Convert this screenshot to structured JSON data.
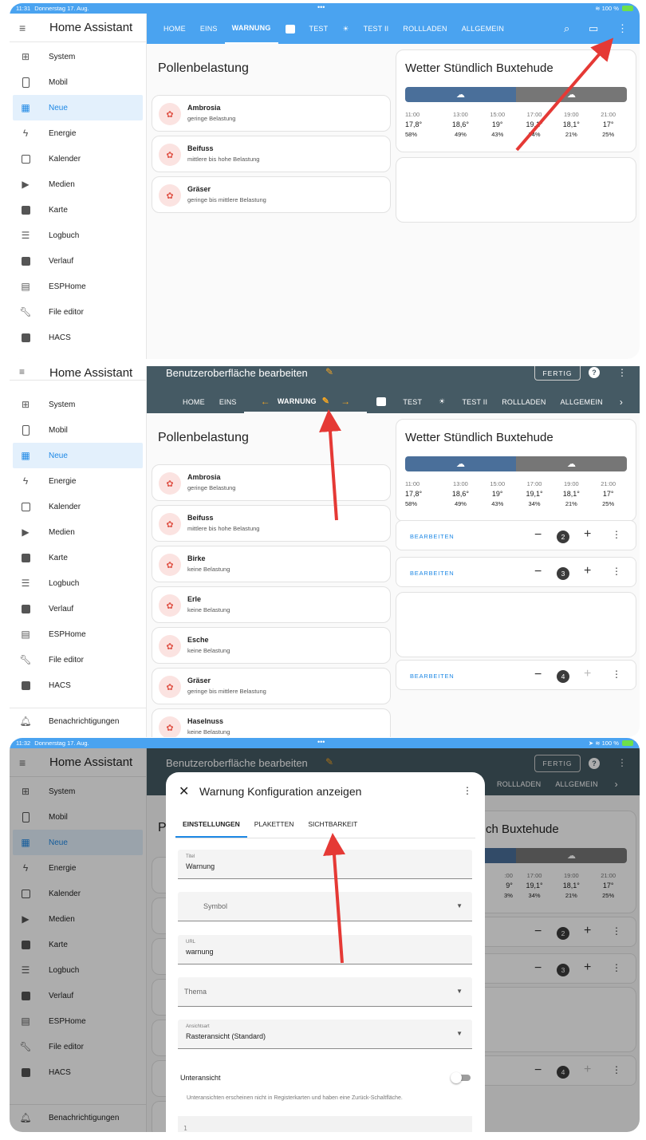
{
  "panel1": {
    "status": {
      "time": "11:31",
      "date": "Donnerstag 17. Aug.",
      "dots": "•••",
      "right": "100 %"
    },
    "app_title": "Home Assistant",
    "tabs": [
      "HOME",
      "EINS",
      "WARNUNG",
      "TEST",
      "TEST II",
      "ROLLLADEN",
      "ALLGEMEIN"
    ],
    "selected_tab": "WARNUNG"
  },
  "panel2": {
    "edit_title": "Benutzeroberfläche bearbeiten",
    "fertig": "FERTIG",
    "help": "?",
    "tabs": [
      "HOME",
      "EINS",
      "WARNUNG",
      "TEST",
      "TEST II",
      "ROLLLADEN",
      "ALLGEMEIN"
    ],
    "left_arrow": "←",
    "right_arrow": "→",
    "bearbeiten": "BEARBEITEN",
    "badges": [
      "2",
      "3",
      "4"
    ]
  },
  "panel3": {
    "status": {
      "time": "11:32",
      "date": "Donnerstag 17. Aug.",
      "dots": "•••",
      "right": "100 %"
    },
    "bg_tabs": [
      "ROLLLADEN",
      "ALLGEMEIN"
    ],
    "bg_weather_fragment": "ch Buxtehude",
    "bg_times": [
      "19:00",
      "21:00"
    ],
    "bg_temps": [
      "18,1°",
      "17°"
    ],
    "bg_hums": [
      "21%",
      "25%"
    ],
    "bg_partial": {
      "time": "17:00",
      "temp": "19,1°",
      "hum": "34%",
      "time_clip": ":00",
      "temp_clip": "9°",
      "hum_clip": "3%"
    },
    "dialog": {
      "title": "Warnung Konfiguration anzeigen",
      "tabs": [
        "EINSTELLUNGEN",
        "PLAKETTEN",
        "SICHTBARKEIT"
      ],
      "titel_label": "Titel",
      "titel_value": "Warnung",
      "symbol": "Symbol",
      "url_label": "URL",
      "url_value": "warnung",
      "thema": "Thema",
      "ansicht_label": "Ansichtsart",
      "ansicht_value": "Rasteransicht (Standard)",
      "unteransicht": "Unteransicht",
      "help": "Unteransichten erscheinen nicht in Registerkarten und haben eine Zurück-Schaltfläche.",
      "code_line": "1"
    }
  },
  "sidebar": {
    "items": [
      "System",
      "Mobil",
      "Neue",
      "Energie",
      "Kalender",
      "Medien",
      "Karte",
      "Logbuch",
      "Verlauf",
      "ESPHome",
      "File editor",
      "HACS"
    ],
    "active": "Neue",
    "notifications": "Benachrichtigungen"
  },
  "pollen": {
    "title": "Pollenbelastung",
    "short": [
      {
        "name": "Ambrosia",
        "level": "geringe Belastung"
      },
      {
        "name": "Beifuss",
        "level": "mittlere bis hohe Belastung"
      },
      {
        "name": "Gräser",
        "level": "geringe bis mittlere Belastung"
      }
    ],
    "full": [
      {
        "name": "Ambrosia",
        "level": "geringe Belastung"
      },
      {
        "name": "Beifuss",
        "level": "mittlere bis hohe Belastung"
      },
      {
        "name": "Birke",
        "level": "keine Belastung"
      },
      {
        "name": "Erle",
        "level": "keine Belastung"
      },
      {
        "name": "Esche",
        "level": "keine Belastung"
      },
      {
        "name": "Gräser",
        "level": "geringe bis mittlere Belastung"
      },
      {
        "name": "Haselnuss",
        "level": "keine Belastung"
      }
    ]
  },
  "weather": {
    "title": "Wetter Stündlich Buxtehude",
    "times": [
      "11:00",
      "13:00",
      "15:00",
      "17:00",
      "19:00",
      "21:00"
    ],
    "temps": [
      "17,8°",
      "18,6°",
      "19°",
      "19,1°",
      "18,1°",
      "17°"
    ],
    "humidity": [
      "58%",
      "49%",
      "43%",
      "34%",
      "21%",
      "25%"
    ]
  },
  "colors": {
    "header_blue": "#03a9f4",
    "edit_dark": "#455a64",
    "accent": "#1e88e5",
    "arrow_red": "#e53935"
  }
}
